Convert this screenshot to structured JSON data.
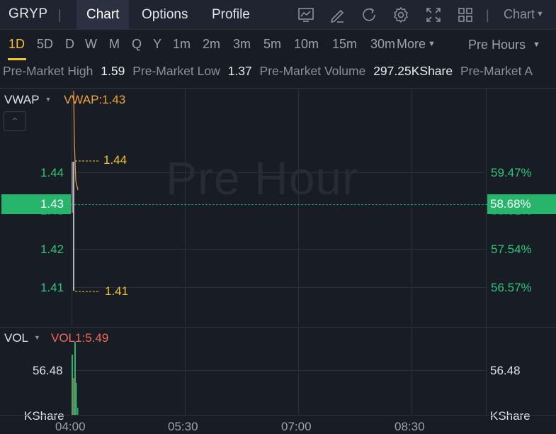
{
  "header": {
    "ticker": "GRYP",
    "separator": "|",
    "tabs": [
      {
        "label": "Chart",
        "active": true
      },
      {
        "label": "Options",
        "active": false
      },
      {
        "label": "Profile",
        "active": false
      }
    ],
    "toolbar_icons": [
      "chart-type-icon",
      "draw-icon",
      "refresh-icon",
      "settings-icon",
      "fullscreen-icon",
      "layout-icon"
    ],
    "chart_dropdown": "Chart"
  },
  "periods": {
    "items": [
      "1D",
      "5D",
      "D",
      "W",
      "M",
      "Q",
      "Y",
      "1m",
      "2m",
      "3m",
      "5m",
      "10m",
      "15m",
      "30m"
    ],
    "active": "1D",
    "more_label": "More",
    "session_dropdown": "Pre Hours"
  },
  "stats": {
    "high_label": "Pre-Market High",
    "high_value": "1.59",
    "low_label": "Pre-Market Low",
    "low_value": "1.37",
    "volume_label": "Pre-Market Volume",
    "volume_value": "297.25KShare",
    "next_label": "Pre-Market A"
  },
  "chart": {
    "watermark": "Pre Hour",
    "indicator_name": "VWAP",
    "indicator_value": "VWAP:1.43",
    "collapse_symbol": "⌃",
    "y_left_labels": [
      "1.44",
      "1.42",
      "1.41"
    ],
    "y_right_labels": [
      "59.47%",
      "57.54%",
      "56.57%"
    ],
    "y_left_hidden": "1.43",
    "y_right_hidden": "58.51%",
    "current_price": "1.43",
    "current_pct": "58.68%",
    "high_marker": "1.44",
    "low_marker": "1.41",
    "colors": {
      "up": "#26b56b",
      "vwap": "#f0a13a",
      "marker": "#f2c230",
      "price_line": "#ffffff"
    }
  },
  "volume": {
    "indicator_name": "VOL",
    "indicator_value": "VOL1:5.49",
    "left_labels": [
      "56.48",
      "KShare"
    ],
    "right_labels": [
      "56.48",
      "KShare"
    ]
  },
  "time_axis": [
    "04:00",
    "05:30",
    "07:00",
    "08:30"
  ]
}
